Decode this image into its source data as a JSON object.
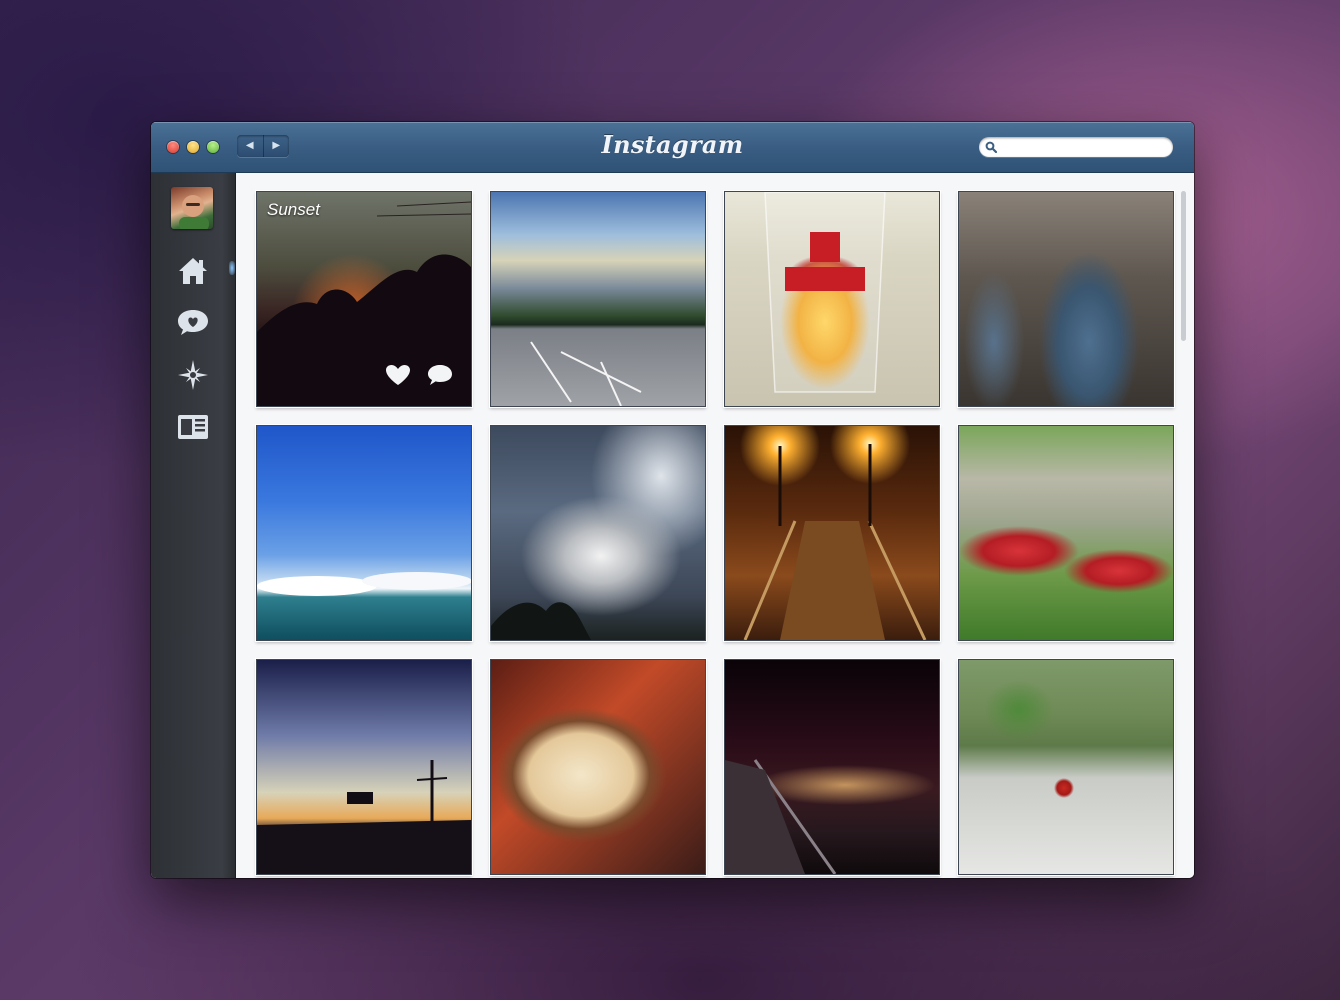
{
  "window": {
    "brand": "Instagram"
  },
  "toolbar": {
    "back_label": "◀",
    "forward_label": "▶"
  },
  "search": {
    "placeholder": "",
    "value": ""
  },
  "sidebar": {
    "items": [
      {
        "name": "home",
        "icon": "home-icon"
      },
      {
        "name": "activity",
        "icon": "heart-bubble-icon"
      },
      {
        "name": "explore",
        "icon": "compass-icon"
      },
      {
        "name": "news",
        "icon": "news-icon"
      }
    ],
    "active": "home"
  },
  "feed": {
    "photos": [
      {
        "caption": "Sunset"
      },
      {
        "caption": ""
      },
      {
        "caption": ""
      },
      {
        "caption": ""
      },
      {
        "caption": ""
      },
      {
        "caption": ""
      },
      {
        "caption": ""
      },
      {
        "caption": ""
      },
      {
        "caption": ""
      },
      {
        "caption": ""
      },
      {
        "caption": ""
      },
      {
        "caption": ""
      }
    ]
  },
  "colors": {
    "titlebar": "#3a5e83",
    "sidebar": "#35383d",
    "content": "#f6f7f8"
  }
}
